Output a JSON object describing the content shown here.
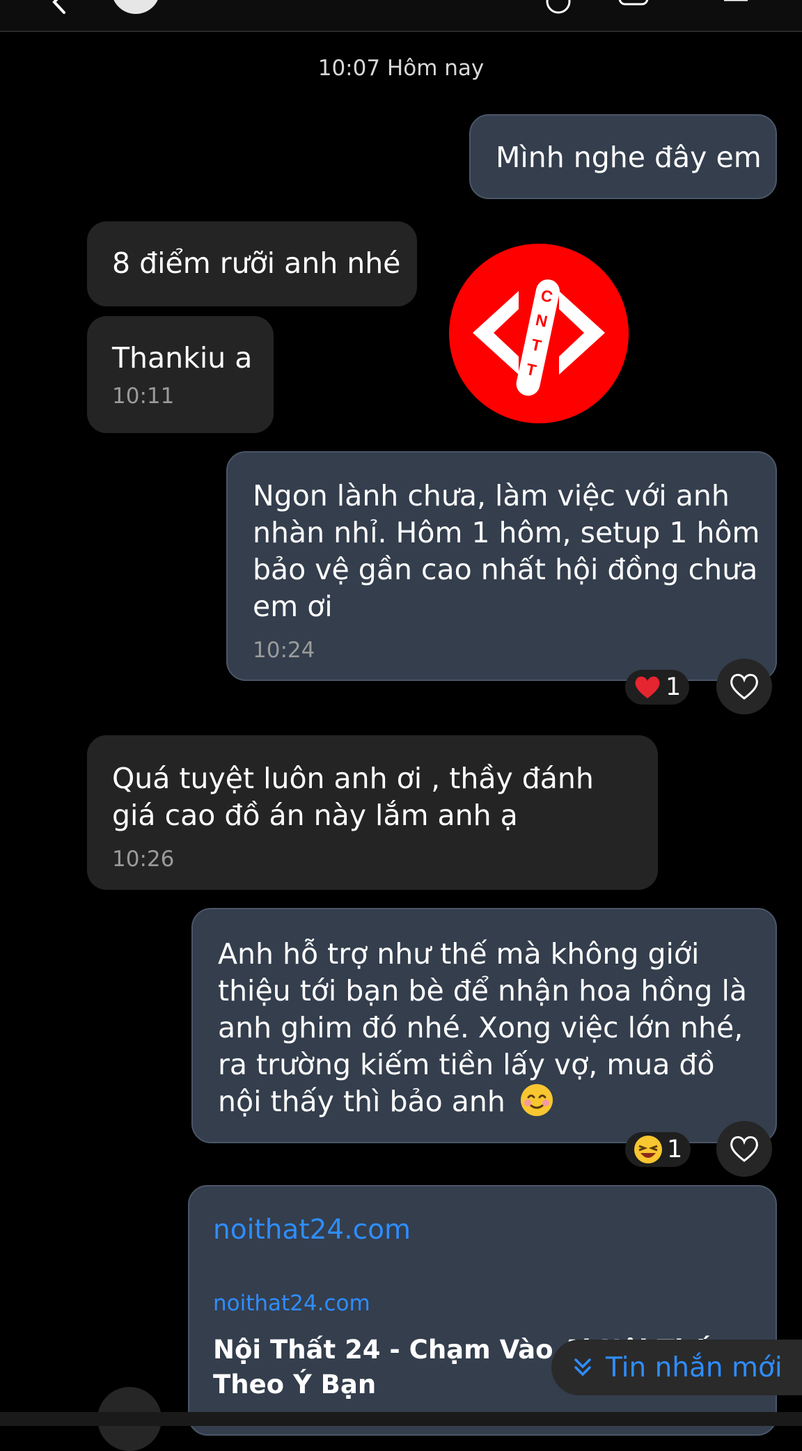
{
  "conversation": {
    "day_header": "10:07 Hôm nay"
  },
  "messages": [
    {
      "direction": "out",
      "text": "Mình nghe đây em"
    },
    {
      "direction": "in",
      "text": "8 điểm rưỡi anh nhé"
    },
    {
      "direction": "in",
      "text": "Thankiu a",
      "time": "10:11"
    },
    {
      "direction": "out",
      "text": "Ngon lành chưa, làm việc với anh nhàn nhỉ. Hôm 1 hôm, setup 1 hôm bảo vệ gần cao nhất hội đồng chưa em ơi",
      "time": "10:24",
      "reaction": {
        "icon": "red-heart-emoji",
        "count": "1"
      }
    },
    {
      "direction": "in",
      "text": "Quá tuyệt luôn anh ơi , thầy đánh giá cao đồ án này lắm anh ạ",
      "time": "10:26"
    },
    {
      "direction": "out",
      "text": "Anh hỗ trợ như thế mà không giới thiệu tới bạn bè để nhận hoa hồng là anh ghim đó nhé. Xong việc lớn nhé, ra trường kiếm tiền lấy vợ, mua đồ nội thấy thì bảo anh",
      "emoji": "smiling-face-emoji",
      "reaction": {
        "icon": "laughing-face-emoji",
        "count": "1"
      }
    }
  ],
  "sticker": {
    "icon": "cntt-code-logo",
    "letters": [
      "C",
      "N",
      "T",
      "T"
    ],
    "color": "#ff0000"
  },
  "link_preview": {
    "url": "noithat24.com",
    "domain": "noithat24.com",
    "title": "Nội Thất 24 - Chạm Vào Ai Nội Thất Theo Ý Bạn"
  },
  "new_message_button": {
    "label": "Tin nhắn mới",
    "icon": "double-chevron-down-icon"
  },
  "colors": {
    "background": "#000000",
    "outgoing_bubble": "#343e4d",
    "incoming_bubble": "#242424",
    "link": "#2f8dff",
    "sticker_red": "#ff0000"
  }
}
